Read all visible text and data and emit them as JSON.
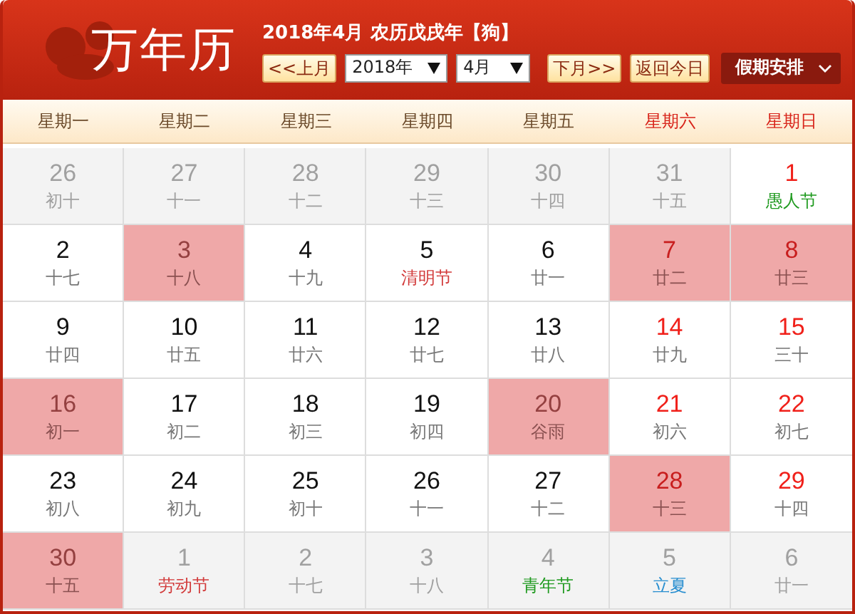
{
  "header": {
    "logo": "万年历",
    "info": "2018年4月 农历戊戌年【狗】",
    "prev_button": "<<上月",
    "year_select": "2018年",
    "month_select": "4月",
    "next_button": "下月>>",
    "today_button": "返回今日",
    "holiday_menu": "假期安排"
  },
  "weekdays": [
    {
      "label": "星期一",
      "weekend": false
    },
    {
      "label": "星期二",
      "weekend": false
    },
    {
      "label": "星期三",
      "weekend": false
    },
    {
      "label": "星期四",
      "weekend": false
    },
    {
      "label": "星期五",
      "weekend": false
    },
    {
      "label": "星期六",
      "weekend": true
    },
    {
      "label": "星期日",
      "weekend": true
    }
  ],
  "weeks": [
    [
      {
        "day": "26",
        "note": "初十",
        "kind": "lunar",
        "other_month": true,
        "highlighted": false
      },
      {
        "day": "27",
        "note": "十一",
        "kind": "lunar",
        "other_month": true,
        "highlighted": false
      },
      {
        "day": "28",
        "note": "十二",
        "kind": "lunar",
        "other_month": true,
        "highlighted": false
      },
      {
        "day": "29",
        "note": "十三",
        "kind": "lunar",
        "other_month": true,
        "highlighted": false
      },
      {
        "day": "30",
        "note": "十四",
        "kind": "lunar",
        "other_month": true,
        "highlighted": false
      },
      {
        "day": "31",
        "note": "十五",
        "kind": "lunar",
        "other_month": true,
        "highlighted": false
      },
      {
        "day": "1",
        "note": "愚人节",
        "kind": "festival",
        "color": "#1f9a1f",
        "other_month": false,
        "highlighted": false
      }
    ],
    [
      {
        "day": "2",
        "note": "十七",
        "kind": "lunar",
        "other_month": false,
        "highlighted": false
      },
      {
        "day": "3",
        "note": "十八",
        "kind": "lunar",
        "other_month": false,
        "highlighted": true
      },
      {
        "day": "4",
        "note": "十九",
        "kind": "lunar",
        "other_month": false,
        "highlighted": false
      },
      {
        "day": "5",
        "note": "清明节",
        "kind": "festival",
        "color": "#d23a3a",
        "other_month": false,
        "highlighted": false
      },
      {
        "day": "6",
        "note": "廿一",
        "kind": "lunar",
        "other_month": false,
        "highlighted": false
      },
      {
        "day": "7",
        "note": "廿二",
        "kind": "lunar",
        "other_month": false,
        "highlighted": true
      },
      {
        "day": "8",
        "note": "廿三",
        "kind": "lunar",
        "other_month": false,
        "highlighted": true
      }
    ],
    [
      {
        "day": "9",
        "note": "廿四",
        "kind": "lunar",
        "other_month": false,
        "highlighted": false
      },
      {
        "day": "10",
        "note": "廿五",
        "kind": "lunar",
        "other_month": false,
        "highlighted": false
      },
      {
        "day": "11",
        "note": "廿六",
        "kind": "lunar",
        "other_month": false,
        "highlighted": false
      },
      {
        "day": "12",
        "note": "廿七",
        "kind": "lunar",
        "other_month": false,
        "highlighted": false
      },
      {
        "day": "13",
        "note": "廿八",
        "kind": "lunar",
        "other_month": false,
        "highlighted": false
      },
      {
        "day": "14",
        "note": "廿九",
        "kind": "lunar",
        "other_month": false,
        "highlighted": false
      },
      {
        "day": "15",
        "note": "三十",
        "kind": "lunar",
        "other_month": false,
        "highlighted": false
      }
    ],
    [
      {
        "day": "16",
        "note": "初一",
        "kind": "lunar",
        "other_month": false,
        "highlighted": true
      },
      {
        "day": "17",
        "note": "初二",
        "kind": "lunar",
        "other_month": false,
        "highlighted": false
      },
      {
        "day": "18",
        "note": "初三",
        "kind": "lunar",
        "other_month": false,
        "highlighted": false
      },
      {
        "day": "19",
        "note": "初四",
        "kind": "lunar",
        "other_month": false,
        "highlighted": false
      },
      {
        "day": "20",
        "note": "谷雨",
        "kind": "lunar",
        "other_month": false,
        "highlighted": true
      },
      {
        "day": "21",
        "note": "初六",
        "kind": "lunar",
        "other_month": false,
        "highlighted": false
      },
      {
        "day": "22",
        "note": "初七",
        "kind": "lunar",
        "other_month": false,
        "highlighted": false
      }
    ],
    [
      {
        "day": "23",
        "note": "初八",
        "kind": "lunar",
        "other_month": false,
        "highlighted": false
      },
      {
        "day": "24",
        "note": "初九",
        "kind": "lunar",
        "other_month": false,
        "highlighted": false
      },
      {
        "day": "25",
        "note": "初十",
        "kind": "lunar",
        "other_month": false,
        "highlighted": false
      },
      {
        "day": "26",
        "note": "十一",
        "kind": "lunar",
        "other_month": false,
        "highlighted": false
      },
      {
        "day": "27",
        "note": "十二",
        "kind": "lunar",
        "other_month": false,
        "highlighted": false
      },
      {
        "day": "28",
        "note": "十三",
        "kind": "lunar",
        "other_month": false,
        "highlighted": true
      },
      {
        "day": "29",
        "note": "十四",
        "kind": "lunar",
        "other_month": false,
        "highlighted": false
      }
    ],
    [
      {
        "day": "30",
        "note": "十五",
        "kind": "lunar",
        "other_month": false,
        "highlighted": true
      },
      {
        "day": "1",
        "note": "劳动节",
        "kind": "festival",
        "color": "#d23a3a",
        "other_month": true,
        "highlighted": false
      },
      {
        "day": "2",
        "note": "十七",
        "kind": "lunar",
        "other_month": true,
        "highlighted": false
      },
      {
        "day": "3",
        "note": "十八",
        "kind": "lunar",
        "other_month": true,
        "highlighted": false
      },
      {
        "day": "4",
        "note": "青年节",
        "kind": "festival",
        "color": "#1f9a1f",
        "other_month": true,
        "highlighted": false
      },
      {
        "day": "5",
        "note": "立夏",
        "kind": "festival",
        "color": "#2a8fd0",
        "other_month": true,
        "highlighted": false
      },
      {
        "day": "6",
        "note": "廿一",
        "kind": "lunar",
        "other_month": true,
        "highlighted": false
      }
    ]
  ]
}
